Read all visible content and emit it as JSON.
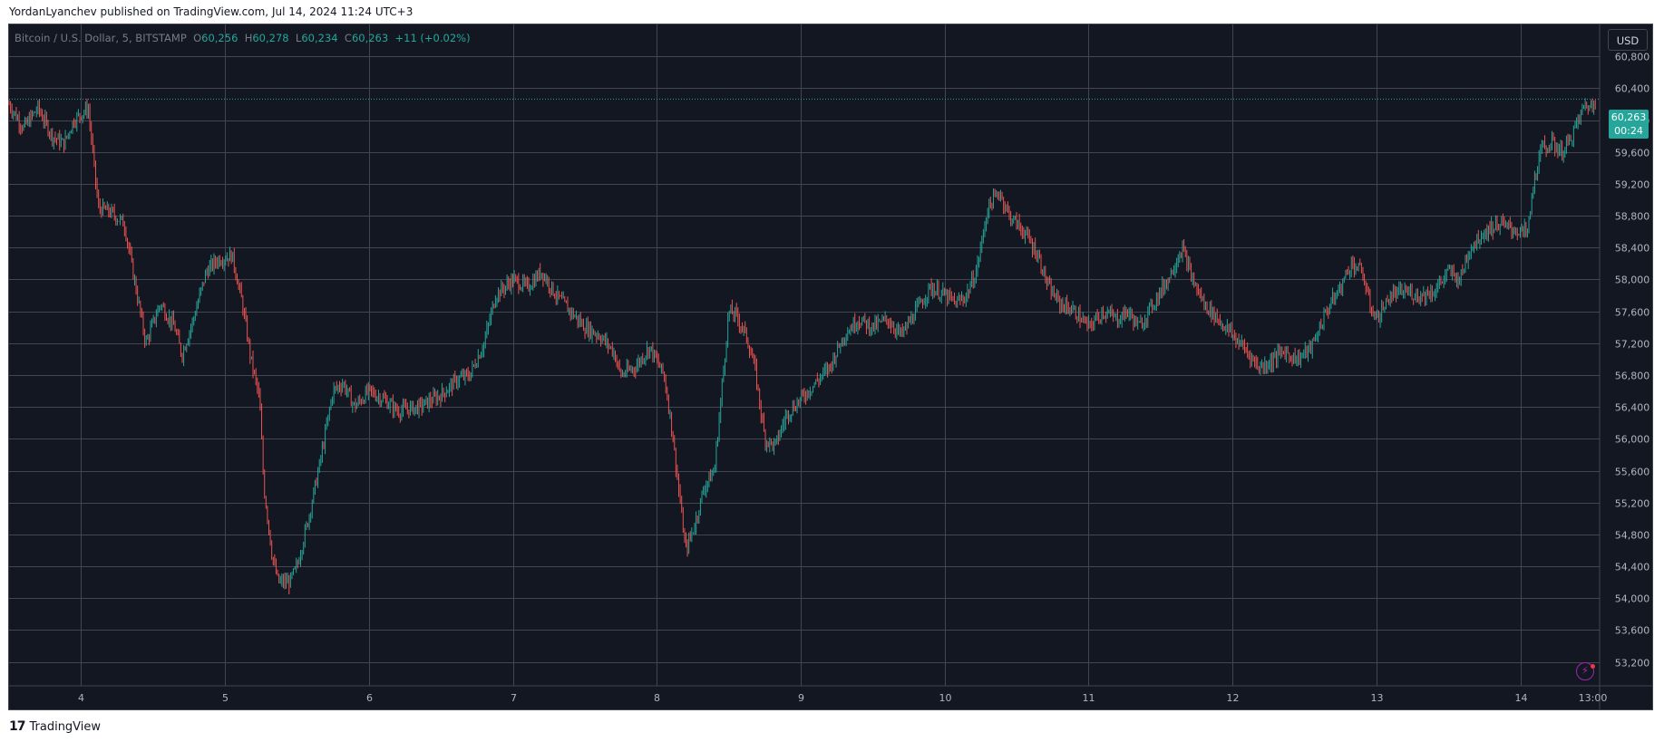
{
  "header": {
    "caption": "YordanLyanchev published on TradingView.com, Jul 14, 2024 11:24 UTC+3"
  },
  "legend": {
    "symbol": "Bitcoin / U.S. Dollar, 5, BITSTAMP",
    "o_label": "O",
    "o_value": "60,256",
    "h_label": "H",
    "h_value": "60,278",
    "l_label": "L",
    "l_value": "60,234",
    "c_label": "C",
    "c_value": "60,263",
    "change": "+11 (+0.02%)"
  },
  "currency_button": "USD",
  "last_price": {
    "price": "60,263",
    "countdown": "00:24"
  },
  "footer": {
    "brand": "TradingView",
    "logo_icon": "tradingview-logo-icon"
  },
  "colors": {
    "up": "#26a69a",
    "down": "#ef5350",
    "background": "#131722",
    "grid": "#434651"
  },
  "chart_data": {
    "type": "candlestick",
    "symbol": "BTCUSD",
    "timeframe": "5",
    "y_axis": {
      "position": "right",
      "range": [
        52900,
        61200
      ],
      "ticks": [
        53200,
        53600,
        54000,
        54400,
        54800,
        55200,
        55600,
        56000,
        56400,
        56800,
        57200,
        57600,
        58000,
        58400,
        58800,
        59200,
        59600,
        60000,
        60400,
        60800
      ],
      "tick_labels": [
        "53,200",
        "53,600",
        "54,000",
        "54,400",
        "54,800",
        "55,200",
        "55,600",
        "56,000",
        "56,400",
        "56,800",
        "57,200",
        "57,600",
        "58,000",
        "58,400",
        "58,800",
        "59,200",
        "59,600",
        "60,000",
        "60,400",
        "60,800"
      ]
    },
    "x_axis": {
      "range": [
        3.5,
        14.55
      ],
      "ticks": [
        4,
        5,
        6,
        7,
        8,
        9,
        10,
        11,
        12,
        13,
        14,
        14.5
      ],
      "tick_labels": [
        "4",
        "5",
        "6",
        "7",
        "8",
        "9",
        "10",
        "11",
        "12",
        "13",
        "14",
        "13:00"
      ]
    },
    "last_price": 60263,
    "grid": true,
    "price_path": [
      [
        3.5,
        60200
      ],
      [
        3.6,
        59900
      ],
      [
        3.7,
        60150
      ],
      [
        3.8,
        59800
      ],
      [
        3.88,
        59700
      ],
      [
        3.95,
        60000
      ],
      [
        4.05,
        60150
      ],
      [
        4.12,
        58900
      ],
      [
        4.2,
        58850
      ],
      [
        4.3,
        58700
      ],
      [
        4.38,
        57900
      ],
      [
        4.45,
        57200
      ],
      [
        4.55,
        57700
      ],
      [
        4.65,
        57400
      ],
      [
        4.7,
        57050
      ],
      [
        4.78,
        57500
      ],
      [
        4.87,
        58100
      ],
      [
        4.95,
        58250
      ],
      [
        5.05,
        58300
      ],
      [
        5.12,
        57700
      ],
      [
        5.18,
        57000
      ],
      [
        5.24,
        56500
      ],
      [
        5.27,
        55400
      ],
      [
        5.33,
        54500
      ],
      [
        5.37,
        54200
      ],
      [
        5.45,
        54200
      ],
      [
        5.5,
        54400
      ],
      [
        5.58,
        55000
      ],
      [
        5.66,
        55700
      ],
      [
        5.75,
        56600
      ],
      [
        5.82,
        56700
      ],
      [
        5.9,
        56400
      ],
      [
        6.0,
        56600
      ],
      [
        6.1,
        56500
      ],
      [
        6.2,
        56350
      ],
      [
        6.35,
        56400
      ],
      [
        6.5,
        56550
      ],
      [
        6.62,
        56750
      ],
      [
        6.7,
        56800
      ],
      [
        6.8,
        57200
      ],
      [
        6.88,
        57800
      ],
      [
        7.0,
        58000
      ],
      [
        7.1,
        57900
      ],
      [
        7.2,
        58100
      ],
      [
        7.3,
        57800
      ],
      [
        7.4,
        57600
      ],
      [
        7.5,
        57400
      ],
      [
        7.6,
        57300
      ],
      [
        7.7,
        57100
      ],
      [
        7.75,
        56800
      ],
      [
        7.85,
        56900
      ],
      [
        7.95,
        57150
      ],
      [
        8.05,
        56800
      ],
      [
        8.1,
        56200
      ],
      [
        8.15,
        55400
      ],
      [
        8.2,
        54600
      ],
      [
        8.26,
        54900
      ],
      [
        8.33,
        55400
      ],
      [
        8.4,
        55600
      ],
      [
        8.45,
        56600
      ],
      [
        8.5,
        57600
      ],
      [
        8.55,
        57550
      ],
      [
        8.62,
        57300
      ],
      [
        8.68,
        56900
      ],
      [
        8.75,
        56000
      ],
      [
        8.82,
        55900
      ],
      [
        8.9,
        56300
      ],
      [
        9.0,
        56500
      ],
      [
        9.1,
        56700
      ],
      [
        9.2,
        56900
      ],
      [
        9.3,
        57300
      ],
      [
        9.4,
        57500
      ],
      [
        9.5,
        57400
      ],
      [
        9.6,
        57500
      ],
      [
        9.7,
        57300
      ],
      [
        9.8,
        57600
      ],
      [
        9.9,
        57900
      ],
      [
        10.0,
        57800
      ],
      [
        10.08,
        57700
      ],
      [
        10.15,
        57800
      ],
      [
        10.22,
        58100
      ],
      [
        10.3,
        58900
      ],
      [
        10.38,
        59100
      ],
      [
        10.45,
        58800
      ],
      [
        10.55,
        58600
      ],
      [
        10.65,
        58300
      ],
      [
        10.72,
        57900
      ],
      [
        10.8,
        57700
      ],
      [
        10.9,
        57600
      ],
      [
        11.0,
        57400
      ],
      [
        11.1,
        57600
      ],
      [
        11.2,
        57500
      ],
      [
        11.27,
        57600
      ],
      [
        11.35,
        57400
      ],
      [
        11.45,
        57700
      ],
      [
        11.55,
        58000
      ],
      [
        11.65,
        58400
      ],
      [
        11.72,
        58000
      ],
      [
        11.8,
        57700
      ],
      [
        11.9,
        57500
      ],
      [
        12.0,
        57300
      ],
      [
        12.1,
        57100
      ],
      [
        12.18,
        56900
      ],
      [
        12.25,
        56950
      ],
      [
        12.35,
        57100
      ],
      [
        12.45,
        57000
      ],
      [
        12.55,
        57150
      ],
      [
        12.65,
        57600
      ],
      [
        12.75,
        57900
      ],
      [
        12.82,
        58200
      ],
      [
        12.9,
        58100
      ],
      [
        12.95,
        57700
      ],
      [
        13.0,
        57500
      ],
      [
        13.1,
        57800
      ],
      [
        13.2,
        57850
      ],
      [
        13.3,
        57800
      ],
      [
        13.4,
        57850
      ],
      [
        13.5,
        58100
      ],
      [
        13.58,
        58000
      ],
      [
        13.65,
        58400
      ],
      [
        13.75,
        58600
      ],
      [
        13.85,
        58700
      ],
      [
        13.92,
        58650
      ],
      [
        14.0,
        58600
      ],
      [
        14.05,
        58600
      ],
      [
        14.1,
        59300
      ],
      [
        14.15,
        59650
      ],
      [
        14.22,
        59700
      ],
      [
        14.3,
        59600
      ],
      [
        14.38,
        59900
      ],
      [
        14.45,
        60200
      ],
      [
        14.5,
        60150
      ],
      [
        14.52,
        60263
      ]
    ]
  }
}
